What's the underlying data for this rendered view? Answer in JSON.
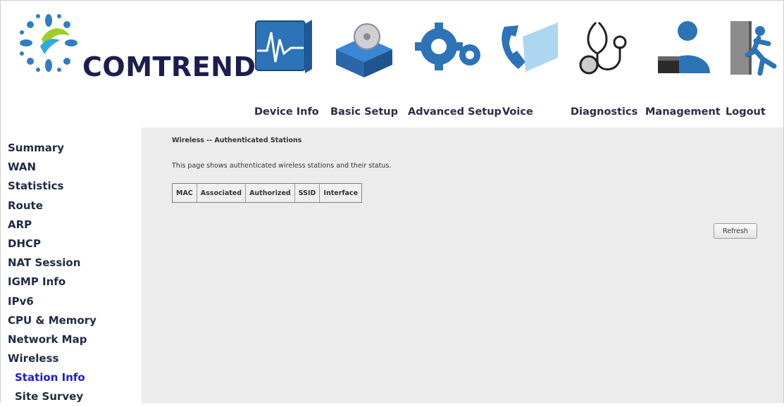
{
  "brand": {
    "name": "COMTREND"
  },
  "nav": [
    {
      "label": "Device Info",
      "icon": "device-info-icon"
    },
    {
      "label": "Basic Setup",
      "icon": "basic-setup-icon"
    },
    {
      "label": "Advanced Setup",
      "icon": "advanced-setup-icon"
    },
    {
      "label": "Voice",
      "icon": "voice-icon"
    },
    {
      "label": "Diagnostics",
      "icon": "diagnostics-icon"
    },
    {
      "label": "Management",
      "icon": "management-icon"
    },
    {
      "label": "Logout",
      "icon": "logout-icon"
    }
  ],
  "sidebar": {
    "items": [
      {
        "label": "Summary"
      },
      {
        "label": "WAN"
      },
      {
        "label": "Statistics"
      },
      {
        "label": "Route"
      },
      {
        "label": "ARP"
      },
      {
        "label": "DHCP"
      },
      {
        "label": "NAT Session"
      },
      {
        "label": "IGMP Info"
      },
      {
        "label": "IPv6"
      },
      {
        "label": "CPU & Memory"
      },
      {
        "label": "Network Map"
      },
      {
        "label": "Wireless"
      },
      {
        "label": "Station Info",
        "active": true
      },
      {
        "label": "Site Survey"
      }
    ]
  },
  "main": {
    "heading": "Wireless -- Authenticated Stations",
    "description": "This page shows authenticated wireless stations and their status.",
    "table": {
      "columns": [
        "MAC",
        "Associated",
        "Authorized",
        "SSID",
        "Interface"
      ],
      "rows": []
    },
    "refresh_label": "Refresh"
  },
  "colors": {
    "nav_text": "#2b2b4a",
    "active_link": "#1d1dd1",
    "content_bg": "#ececec"
  }
}
